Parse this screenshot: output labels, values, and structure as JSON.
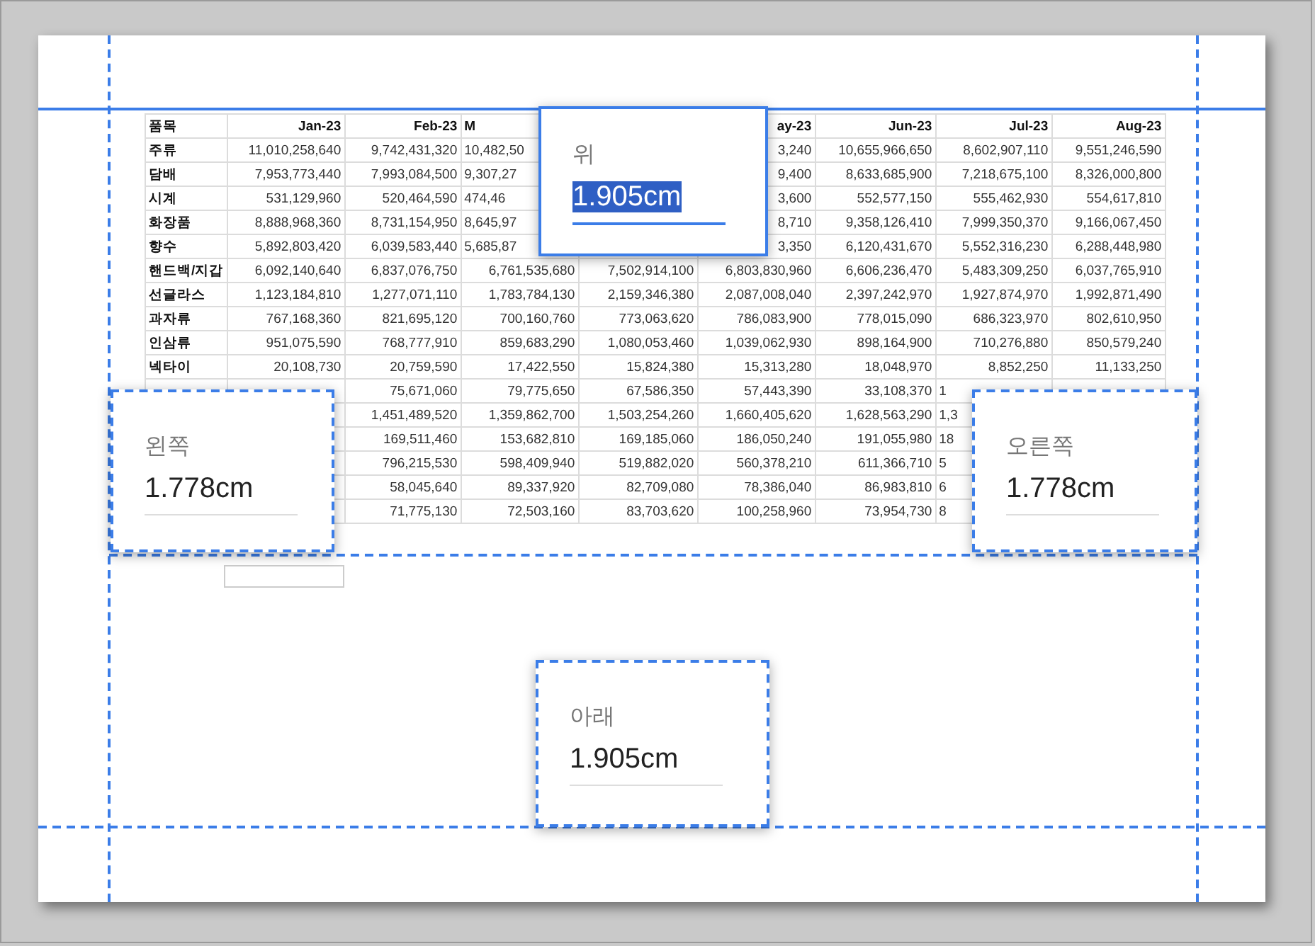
{
  "table": {
    "columns": [
      "품목",
      "Jan-23",
      "Feb-23",
      "M",
      null,
      "ay-23",
      "Jun-23",
      "Jul-23",
      "Aug-23"
    ],
    "rows": [
      [
        "주류",
        "11,010,258,640",
        "9,742,431,320",
        "10,482,50",
        null,
        "3,240",
        "10,655,966,650",
        "8,602,907,110",
        "9,551,246,590"
      ],
      [
        "담배",
        "7,953,773,440",
        "7,993,084,500",
        "9,307,27",
        null,
        "9,400",
        "8,633,685,900",
        "7,218,675,100",
        "8,326,000,800"
      ],
      [
        "시계",
        "531,129,960",
        "520,464,590",
        "474,46",
        null,
        "3,600",
        "552,577,150",
        "555,462,930",
        "554,617,810"
      ],
      [
        "화장품",
        "8,888,968,360",
        "8,731,154,950",
        "8,645,97",
        null,
        "8,710",
        "9,358,126,410",
        "7,999,350,370",
        "9,166,067,450"
      ],
      [
        "향수",
        "5,892,803,420",
        "6,039,583,440",
        "5,685,87",
        null,
        "3,350",
        "6,120,431,670",
        "5,552,316,230",
        "6,288,448,980"
      ],
      [
        "핸드백/지갑",
        "6,092,140,640",
        "6,837,076,750",
        "6,761,535,680",
        "7,502,914,100",
        "6,803,830,960",
        "6,606,236,470",
        "5,483,309,250",
        "6,037,765,910"
      ],
      [
        "선글라스",
        "1,123,184,810",
        "1,277,071,110",
        "1,783,784,130",
        "2,159,346,380",
        "2,087,008,040",
        "2,397,242,970",
        "1,927,874,970",
        "1,992,871,490"
      ],
      [
        "과자류",
        "767,168,360",
        "821,695,120",
        "700,160,760",
        "773,063,620",
        "786,083,900",
        "778,015,090",
        "686,323,970",
        "802,610,950"
      ],
      [
        "인삼류",
        "951,075,590",
        "768,777,910",
        "859,683,290",
        "1,080,053,460",
        "1,039,062,930",
        "898,164,900",
        "710,276,880",
        "850,579,240"
      ],
      [
        "넥타이",
        "20,108,730",
        "20,759,590",
        "17,422,550",
        "15,824,380",
        "15,313,280",
        "18,048,970",
        "8,852,250",
        "11,133,250"
      ],
      [
        null,
        null,
        "75,671,060",
        "79,775,650",
        "67,586,350",
        "57,443,390",
        "33,108,370",
        "1",
        null
      ],
      [
        null,
        null,
        "1,451,489,520",
        "1,359,862,700",
        "1,503,254,260",
        "1,660,405,620",
        "1,628,563,290",
        "1,3",
        null
      ],
      [
        null,
        null,
        "169,511,460",
        "153,682,810",
        "169,185,060",
        "186,050,240",
        "191,055,980",
        "18",
        null
      ],
      [
        null,
        null,
        "796,215,530",
        "598,409,940",
        "519,882,020",
        "560,378,210",
        "611,366,710",
        "5",
        null
      ],
      [
        null,
        null,
        "58,045,640",
        "89,337,920",
        "82,709,080",
        "78,386,040",
        "86,983,810",
        "6",
        null
      ],
      [
        null,
        null,
        "71,775,130",
        "72,503,160",
        "83,703,620",
        "100,258,960",
        "73,954,730",
        "8",
        null
      ]
    ]
  },
  "margins": [
    {
      "label": "위",
      "value": "1.905cm",
      "focused": true
    },
    {
      "label": "왼쪽",
      "value": "1.778cm",
      "focused": false
    },
    {
      "label": "오른쪽",
      "value": "1.778cm",
      "focused": false
    },
    {
      "label": "아래",
      "value": "1.905cm",
      "focused": false
    }
  ]
}
